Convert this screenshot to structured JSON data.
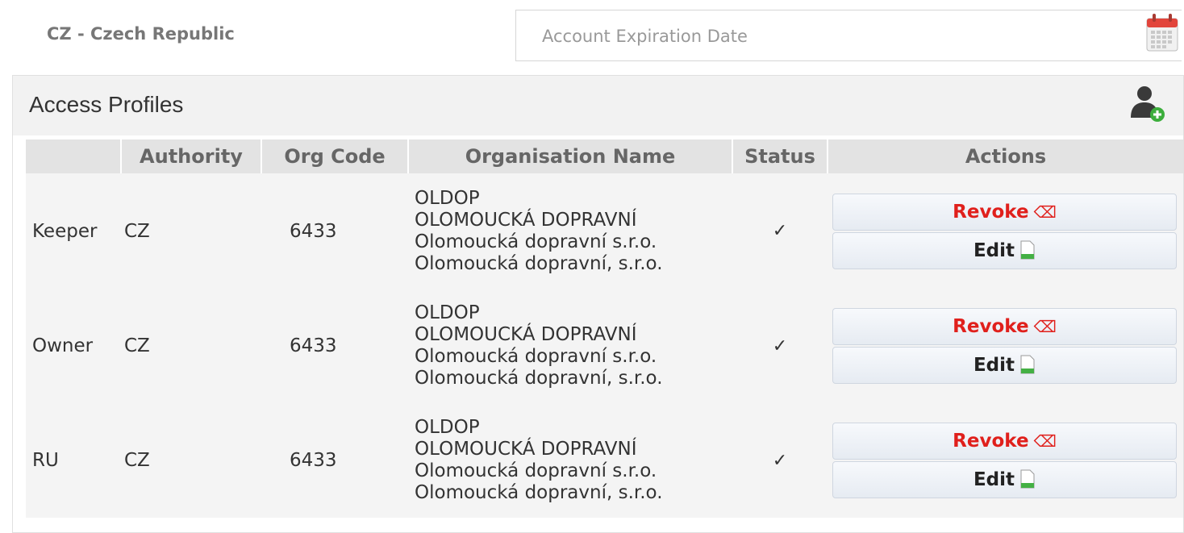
{
  "header": {
    "country": "CZ - Czech Republic",
    "expiry_placeholder": "Account Expiration Date",
    "calendar_icon": "calendar-icon"
  },
  "panel": {
    "title": "Access Profiles",
    "add_icon": "add-user-icon"
  },
  "table": {
    "columns": [
      "",
      "Authority",
      "Org Code",
      "Organisation Name",
      "Status",
      "Actions"
    ],
    "rows": [
      {
        "role": "Keeper",
        "authority": "CZ",
        "org_code": "6433",
        "org_names": [
          "OLDOP",
          "OLOMOUCKÁ DOPRAVNÍ",
          "Olomoucká dopravní s.r.o.",
          "Olomoucká dopravní, s.r.o."
        ],
        "status": "✓",
        "revoke_label": "Revoke",
        "edit_label": "Edit"
      },
      {
        "role": "Owner",
        "authority": "CZ",
        "org_code": "6433",
        "org_names": [
          "OLDOP",
          "OLOMOUCKÁ DOPRAVNÍ",
          "Olomoucká dopravní s.r.o.",
          "Olomoucká dopravní, s.r.o."
        ],
        "status": "✓",
        "revoke_label": "Revoke",
        "edit_label": "Edit"
      },
      {
        "role": "RU",
        "authority": "CZ",
        "org_code": "6433",
        "org_names": [
          "OLDOP",
          "OLOMOUCKÁ DOPRAVNÍ",
          "Olomoucká dopravní s.r.o.",
          "Olomoucká dopravní, s.r.o."
        ],
        "status": "✓",
        "revoke_label": "Revoke",
        "edit_label": "Edit"
      }
    ]
  },
  "colors": {
    "revoke": "#e0201c",
    "header_bg": "#e3e3e3",
    "row_bg": "#f4f4f4"
  }
}
